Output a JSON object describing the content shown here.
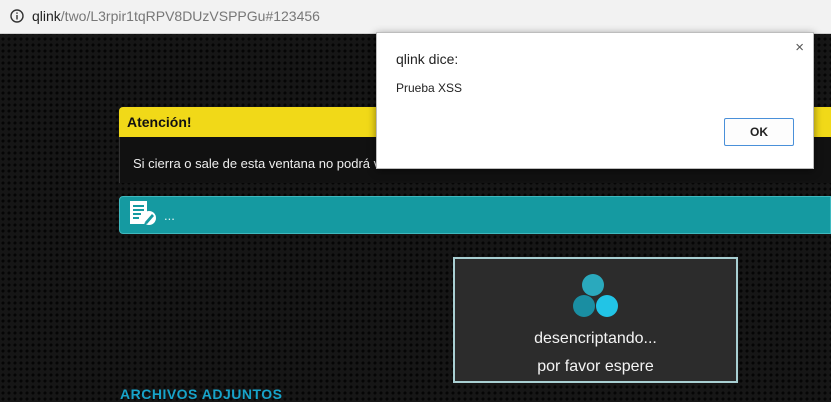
{
  "browser": {
    "url_host": "qlink",
    "url_path": "/two/L3rpir1tqRPV8DUzVSPPGu#123456",
    "info_icon": "info-icon"
  },
  "attention": {
    "title": "Atención!",
    "message": "Si cierra o sale de esta ventana no podrá vol"
  },
  "teal_bar": {
    "icon": "document-edit-icon",
    "text": "..."
  },
  "loading": {
    "icon": "bubbles-loader-icon",
    "line1": "desencriptando...",
    "line2": "por favor espere"
  },
  "attachments": {
    "heading": "ARCHIVOS ADJUNTOS"
  },
  "dialog": {
    "title": "qlink dice:",
    "message": "Prueba XSS",
    "ok_label": "OK",
    "close_glyph": "×"
  },
  "colors": {
    "yellow": "#f1d918",
    "teal": "#159aa1",
    "accent_blue": "#17a3c9",
    "button_border": "#4a90d9"
  }
}
